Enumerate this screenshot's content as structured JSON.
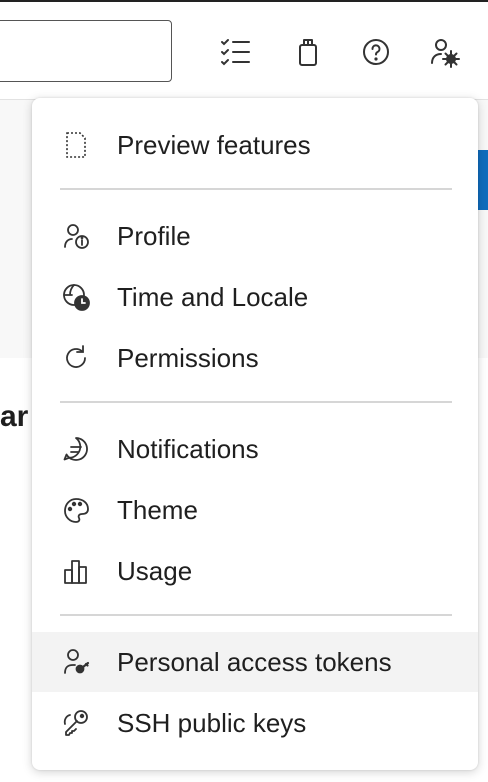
{
  "header": {
    "search": {
      "value": ""
    },
    "icons": [
      "work-items-icon",
      "marketplace-bag-icon",
      "help-icon",
      "user-settings-icon"
    ]
  },
  "menu": {
    "items": [
      {
        "label": "Preview features",
        "icon": "preview-features-icon"
      },
      {
        "label": "Profile",
        "icon": "profile-icon"
      },
      {
        "label": "Time and Locale",
        "icon": "time-locale-icon"
      },
      {
        "label": "Permissions",
        "icon": "permissions-icon"
      },
      {
        "label": "Notifications",
        "icon": "notifications-icon"
      },
      {
        "label": "Theme",
        "icon": "theme-icon"
      },
      {
        "label": "Usage",
        "icon": "usage-icon"
      },
      {
        "label": "Personal access tokens",
        "icon": "personal-access-tokens-icon",
        "selected": true
      },
      {
        "label": "SSH public keys",
        "icon": "ssh-keys-icon"
      }
    ]
  },
  "background": {
    "partial_text": "ar"
  },
  "colors": {
    "accent": "#0f6cbd",
    "selected_bg": "#f3f3f3",
    "divider": "#d6d6d6"
  }
}
